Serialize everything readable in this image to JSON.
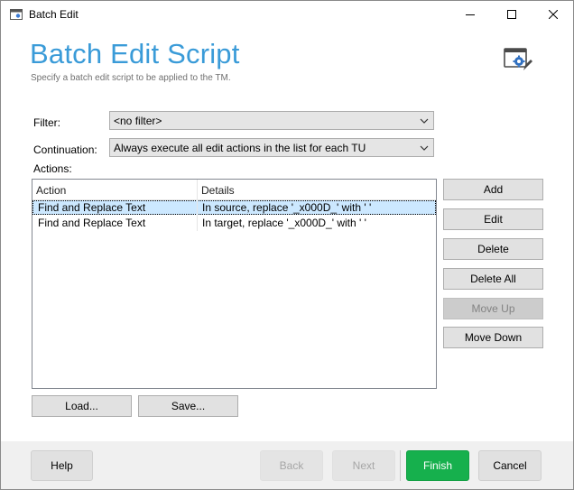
{
  "window": {
    "title": "Batch Edit"
  },
  "header": {
    "title": "Batch Edit Script",
    "subtitle": "Specify a batch edit script to be applied to the TM.",
    "icon": "batch-edit-window-gear-icon"
  },
  "filter": {
    "label": "Filter:",
    "value": "<no filter>"
  },
  "continuation": {
    "label": "Continuation:",
    "value": "Always execute all edit actions in the list for each TU"
  },
  "actions": {
    "label": "Actions:",
    "columns": [
      "Action",
      "Details"
    ],
    "rows": [
      {
        "action": "Find and Replace Text",
        "details": "In source, replace '_x000D_' with ' '",
        "selected": true
      },
      {
        "action": "Find and Replace Text",
        "details": "In target, replace '_x000D_' with ' '",
        "selected": false
      }
    ]
  },
  "side_buttons": {
    "add": "Add",
    "edit": "Edit",
    "delete": "Delete",
    "delete_all": "Delete All",
    "move_up": "Move Up",
    "move_down": "Move Down"
  },
  "bottom_buttons": {
    "load": "Load...",
    "save": "Save..."
  },
  "footer": {
    "help": "Help",
    "back": "Back",
    "next": "Next",
    "finish": "Finish",
    "cancel": "Cancel"
  },
  "colors": {
    "accent_title": "#3a9bd8",
    "finish_green": "#16b04d",
    "selection": "#cce8ff"
  }
}
